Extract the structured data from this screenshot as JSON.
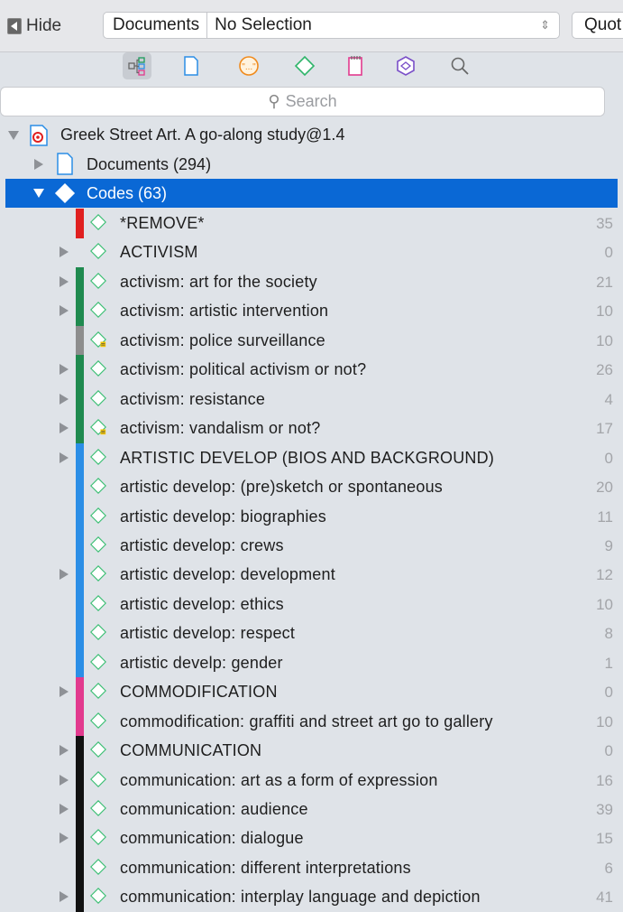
{
  "topbar": {
    "hide_label": "Hide",
    "select_label": "Documents",
    "select_value": "No Selection",
    "quot_label": "Quot"
  },
  "toolbar": {
    "icons": [
      "network-icon",
      "document-icon",
      "quotation-icon",
      "code-icon",
      "memo-icon",
      "network-view-icon",
      "search-icon"
    ]
  },
  "search": {
    "placeholder": "Search"
  },
  "tree": {
    "project": "Greek Street Art. A go-along study@1.4",
    "documents": "Documents (294)",
    "codes": "Codes (63)",
    "items": [
      {
        "label": "*REMOVE*",
        "count": "35",
        "color": "#e02020",
        "expandable": false,
        "memo": false
      },
      {
        "label": "ACTIVISM",
        "count": "0",
        "color": "",
        "expandable": true,
        "memo": false
      },
      {
        "label": "activism: art for the society",
        "count": "21",
        "color": "#1f8a4f",
        "expandable": true,
        "memo": false
      },
      {
        "label": "activism: artistic intervention",
        "count": "10",
        "color": "#1f8a4f",
        "expandable": true,
        "memo": false
      },
      {
        "label": "activism: police surveillance",
        "count": "10",
        "color": "#8d8d8d",
        "expandable": false,
        "memo": true
      },
      {
        "label": "activism: political activism or not?",
        "count": "26",
        "color": "#1f8a4f",
        "expandable": true,
        "memo": false
      },
      {
        "label": "activism: resistance",
        "count": "4",
        "color": "#1f8a4f",
        "expandable": true,
        "memo": false
      },
      {
        "label": "activism: vandalism or not?",
        "count": "17",
        "color": "#1f8a4f",
        "expandable": true,
        "memo": true
      },
      {
        "label": "ARTISTIC DEVELOP (BIOS AND BACKGROUND)",
        "count": "0",
        "color": "#2b8ee6",
        "expandable": true,
        "memo": false
      },
      {
        "label": "artistic develop: (pre)sketch or spontaneous",
        "count": "20",
        "color": "#2b8ee6",
        "expandable": false,
        "memo": false
      },
      {
        "label": "artistic develop: biographies",
        "count": "11",
        "color": "#2b8ee6",
        "expandable": false,
        "memo": false
      },
      {
        "label": "artistic develop: crews",
        "count": "9",
        "color": "#2b8ee6",
        "expandable": false,
        "memo": false
      },
      {
        "label": "artistic develop: development",
        "count": "12",
        "color": "#2b8ee6",
        "expandable": true,
        "memo": false
      },
      {
        "label": "artistic develop: ethics",
        "count": "10",
        "color": "#2b8ee6",
        "expandable": false,
        "memo": false
      },
      {
        "label": "artistic develop: respect",
        "count": "8",
        "color": "#2b8ee6",
        "expandable": false,
        "memo": false
      },
      {
        "label": "artistic develp: gender",
        "count": "1",
        "color": "#2b8ee6",
        "expandable": false,
        "memo": false
      },
      {
        "label": "COMMODIFICATION",
        "count": "0",
        "color": "#e23a8e",
        "expandable": true,
        "memo": false
      },
      {
        "label": "commodification: graffiti and street art go to gallery",
        "count": "10",
        "color": "#e23a8e",
        "expandable": false,
        "memo": false
      },
      {
        "label": "COMMUNICATION",
        "count": "0",
        "color": "#111111",
        "expandable": true,
        "memo": false
      },
      {
        "label": "communication: art as a form of expression",
        "count": "16",
        "color": "#111111",
        "expandable": true,
        "memo": false
      },
      {
        "label": "communication: audience",
        "count": "39",
        "color": "#111111",
        "expandable": true,
        "memo": false
      },
      {
        "label": "communication: dialogue",
        "count": "15",
        "color": "#111111",
        "expandable": true,
        "memo": false
      },
      {
        "label": "communication: different interpretations",
        "count": "6",
        "color": "#111111",
        "expandable": false,
        "memo": false
      },
      {
        "label": "communication: interplay language and depiction",
        "count": "41",
        "color": "#111111",
        "expandable": true,
        "memo": false
      }
    ]
  }
}
